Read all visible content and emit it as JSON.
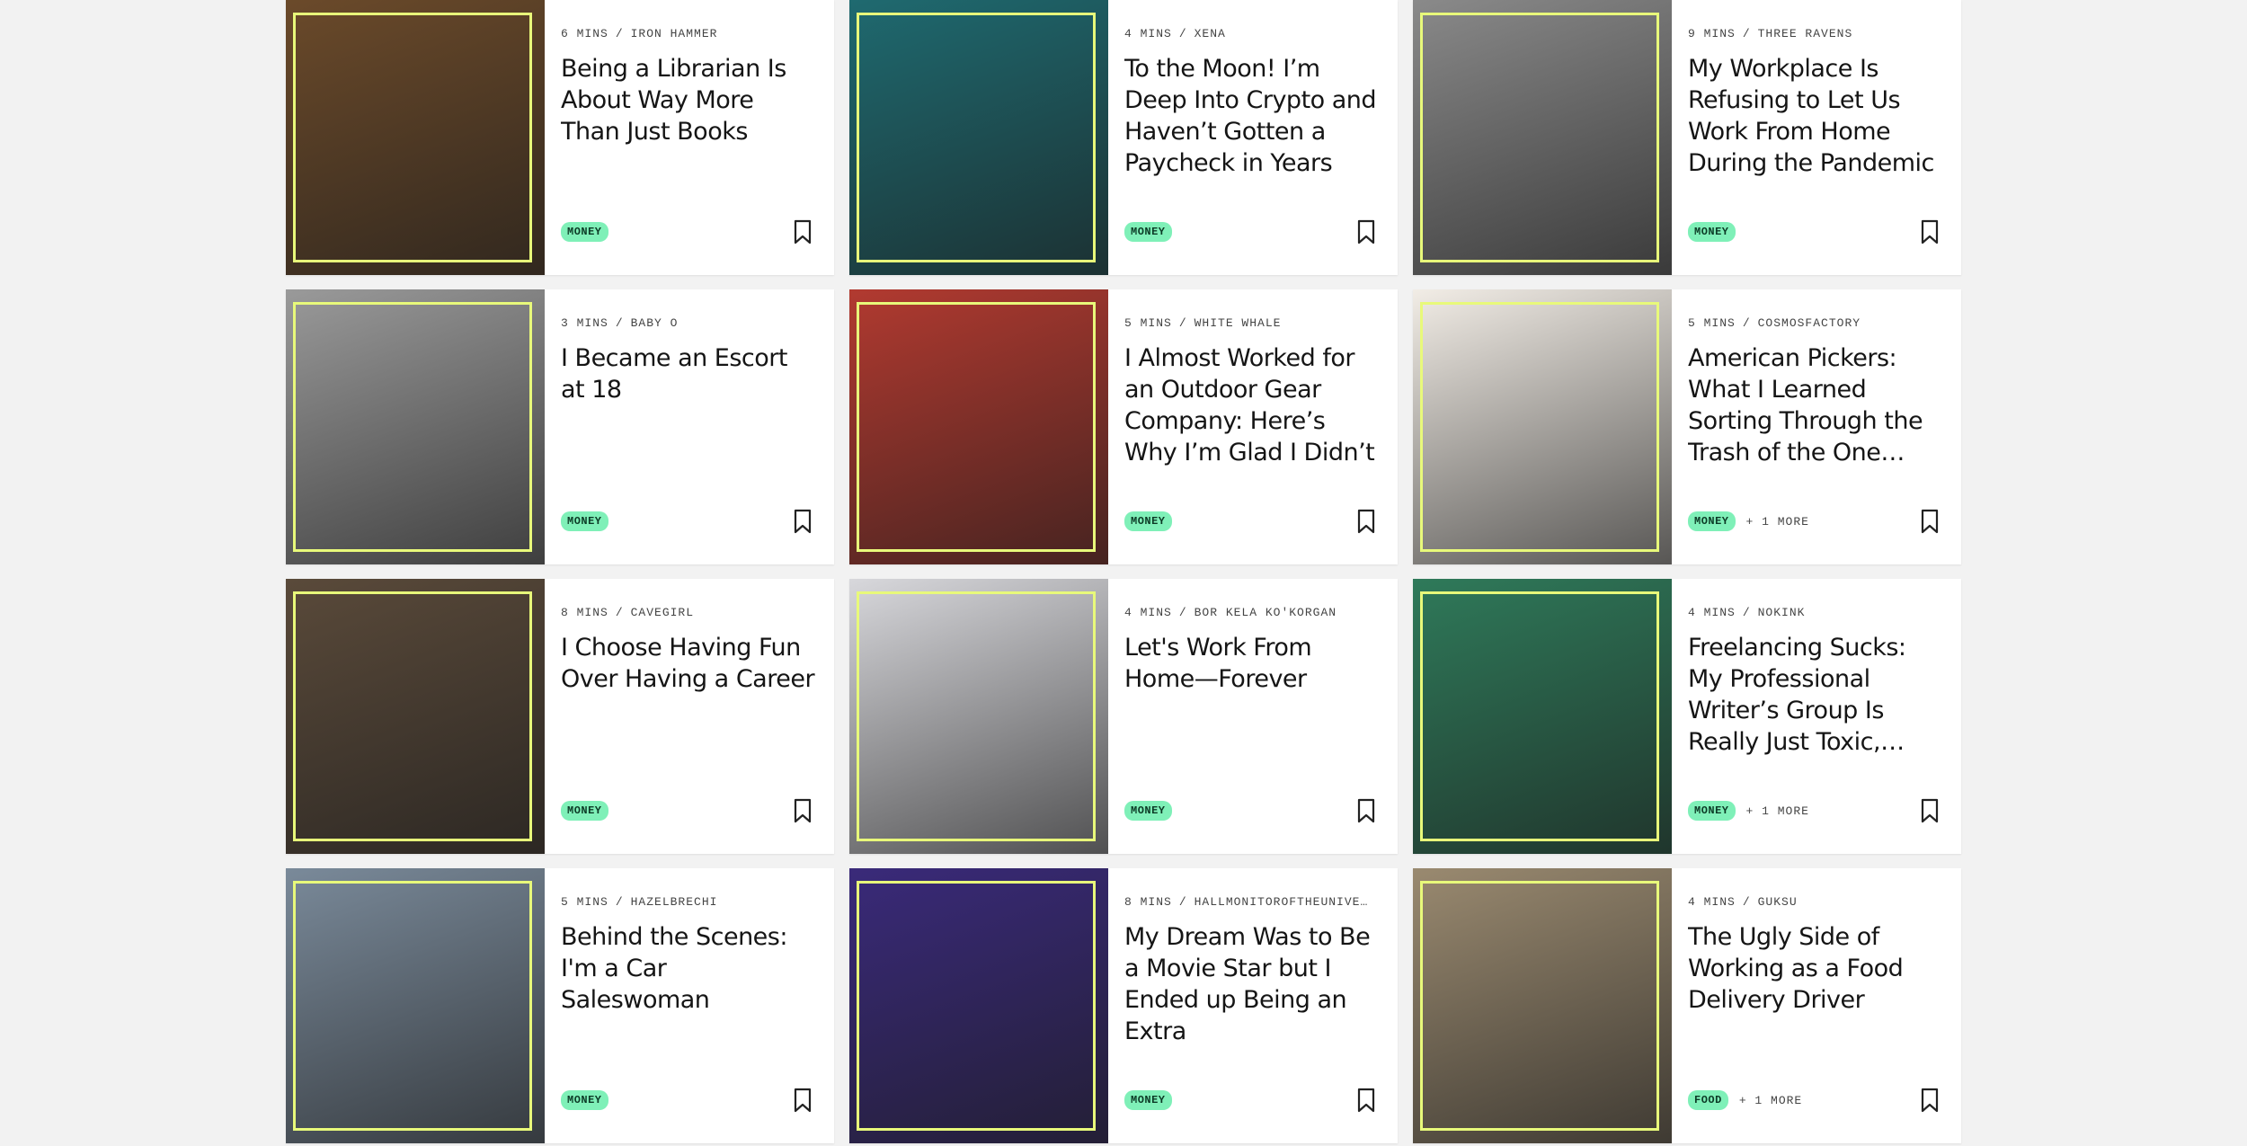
{
  "cards": [
    {
      "mins": "6 MINS",
      "author": "IRON HAMMER",
      "title": "Being a Librarian Is About Way More Than Just Books",
      "tag": "MONEY",
      "more": "",
      "bg": "#6b4a2a",
      "accent": "#3d6b5a"
    },
    {
      "mins": "4 MINS",
      "author": "XENA",
      "title": "To the Moon! I’m Deep Into Crypto and Haven’t Gotten a Paycheck in Years",
      "tag": "MONEY",
      "more": "",
      "bg": "#1f6a70",
      "accent": "#e8f97a"
    },
    {
      "mins": "9 MINS",
      "author": "THREE RAVENS",
      "title": "My Workplace Is Refusing to Let Us Work From Home During the Pandemic",
      "tag": "MONEY",
      "more": "",
      "bg": "#8a8a8a",
      "accent": "#e8f97a"
    },
    {
      "mins": "3 MINS",
      "author": "BABY O",
      "title": "I Became an Escort at 18",
      "tag": "MONEY",
      "more": "",
      "bg": "#9a9a9a",
      "accent": "#3d6b5a"
    },
    {
      "mins": "5 MINS",
      "author": "WHITE WHALE",
      "title": "I Almost Worked for an Outdoor Gear Company: Here’s Why I’m Glad I Didn’t",
      "tag": "MONEY",
      "more": "",
      "bg": "#b23a30",
      "accent": "#3d6b5a"
    },
    {
      "mins": "5 MINS",
      "author": "COSMOSFACTORY",
      "title": "American Pickers: What I Learned Sorting Through the Trash of the One Percent",
      "tag": "MONEY",
      "more": "+ 1 MORE",
      "bg": "#f2ede6",
      "accent": "#14382e"
    },
    {
      "mins": "8 MINS",
      "author": "CAVEGIRL",
      "title": "I Choose Having Fun Over Having a Career",
      "tag": "MONEY",
      "more": "",
      "bg": "#5a4a3a",
      "accent": "#3d6b5a"
    },
    {
      "mins": "4 MINS",
      "author": "BOR KELA KO'KORGAN",
      "title": "Let's Work From Home—Forever",
      "tag": "MONEY",
      "more": "",
      "bg": "#d8d8dc",
      "accent": "#1f3d36"
    },
    {
      "mins": "4 MINS",
      "author": "NOKINK",
      "title": "Freelancing Sucks: My Professional Writer’s Group Is Really Just Toxic, Neoliberal Self…",
      "tag": "MONEY",
      "more": "+ 1 MORE",
      "bg": "#2f7a5a",
      "accent": "#3d6b5a"
    },
    {
      "mins": "5 MINS",
      "author": "HAZELBRECHI",
      "title": "Behind the Scenes: I'm a Car Saleswoman",
      "tag": "MONEY",
      "more": "",
      "bg": "#7a8a9a",
      "accent": "#3d6b5a"
    },
    {
      "mins": "8 MINS",
      "author": "HALLMONITOROFTHEUNIVE…",
      "title": "My Dream Was to Be a Movie Star but I Ended up Being an Extra",
      "tag": "MONEY",
      "more": "",
      "bg": "#3a2a7a",
      "accent": "#1f3d36"
    },
    {
      "mins": "4 MINS",
      "author": "GUKSU",
      "title": "The Ugly Side of Working as a Food Delivery Driver",
      "tag": "FOOD",
      "more": "+ 1 MORE",
      "bg": "#9a8a70",
      "accent": "#5a5a5a"
    }
  ]
}
